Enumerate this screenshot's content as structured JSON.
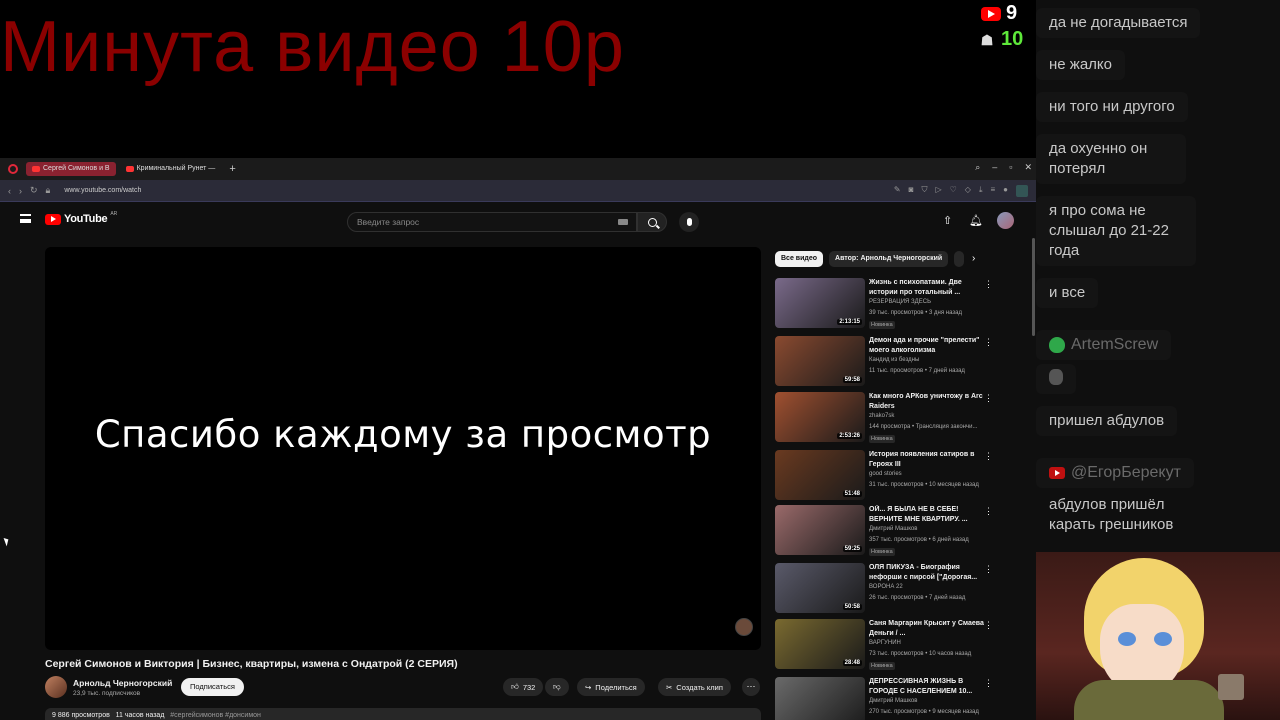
{
  "overlay": {
    "title": "Минута видео 10р",
    "youtube_count": "9",
    "vk_count": "10"
  },
  "chat": {
    "messages": [
      {
        "text": "да не догадывается"
      },
      {
        "text": "не жалко"
      },
      {
        "text": "ни того ни другого"
      },
      {
        "text": "да охуенно он потерял"
      },
      {
        "text": "я про сома не слышал до 21-22 года"
      },
      {
        "text": "и все"
      },
      {
        "user": "ArtemScrew"
      },
      {
        "text": "пришел абдулов"
      },
      {
        "user": "@ЕгорБерекут",
        "text": "абдулов пришёл карать грешников"
      }
    ]
  },
  "browser": {
    "tabs": [
      {
        "label": "Сергей Симонов и В"
      },
      {
        "label": "Криминальный Рунет —"
      }
    ],
    "url": "www.youtube.com/watch"
  },
  "youtube": {
    "logo_text": "YouTube",
    "logo_region": "AR",
    "search_placeholder": "Введите запрос",
    "player_text": "Спасибо каждому за просмотр",
    "video_title": "Сергей Симонов и Виктория | Бизнес, квартиры, измена с Ондатрой (2 СЕРИЯ)",
    "channel_name": "Арнольд Черногорский",
    "channel_subs": "23,9 тыс. подписчиков",
    "subscribe_label": "Подписаться",
    "likes": "732",
    "share_label": "Поделиться",
    "clip_label": "Создать клип",
    "views": "9 886 просмотров",
    "published": "11 часов назад",
    "tags": "#сергейсимонов #донсимон",
    "chips": [
      "Все видео",
      "Автор: Арнольд Черногорский"
    ],
    "recommendations": [
      {
        "title": "Жизнь с психопатами. Две истории про тотальный ...",
        "channel": "РЕЗЕРВАЦИЯ ЗДЕСЬ",
        "meta": "39 тыс. просмотров • 3 дня назад",
        "badge": "Новинка",
        "duration": "2:13:15",
        "color": "#7a6a8a"
      },
      {
        "title": "Демон ада и прочие \"прелести\" моего алкоголизма",
        "channel": "Кандид из бездны",
        "meta": "11 тыс. просмотров • 7 дней назад",
        "badge": "",
        "duration": "59:58",
        "color": "#8a4a30"
      },
      {
        "title": "Как много АРКов уничтожу в Arc Raiders",
        "channel": "zhako7sk",
        "meta": "144 просмотра • Трансляция закончи...",
        "badge": "Новинка",
        "duration": "2:53:26",
        "color": "#a05030"
      },
      {
        "title": "История появления сатиров в Героях III",
        "channel": "good stories",
        "meta": "31 тыс. просмотров • 10 месяцев назад",
        "badge": "",
        "duration": "51:48",
        "color": "#6a3a20"
      },
      {
        "title": "ОЙ... Я БЫЛА НЕ В СЕБЕ! ВЕРНИТЕ МНЕ КВАРТИРУ. ...",
        "channel": "Дмитрий Машков",
        "meta": "357 тыс. просмотров • 6 дней назад",
        "badge": "Новинка",
        "duration": "59:25",
        "color": "#9a6a6a"
      },
      {
        "title": "ОЛЯ ПИКУЗА - Биография нефорши с пирсой [\"Дорогая...",
        "channel": "ВОРОНА 22",
        "meta": "26 тыс. просмотров • 7 дней назад",
        "badge": "",
        "duration": "50:58",
        "color": "#5a5a6a"
      },
      {
        "title": "Саня Маргарин Крысит у Смаева Деньги / ...",
        "channel": "ВАРГУНИН",
        "meta": "73 тыс. просмотров • 10 часов назад",
        "badge": "Новинка",
        "duration": "28:48",
        "color": "#7a6a30"
      },
      {
        "title": "ДЕПРЕССИВНАЯ ЖИЗНЬ В ГОРОДЕ С НАСЕЛЕНИЕМ 10...",
        "channel": "Дмитрий Машков",
        "meta": "270 тыс. просмотров • 9 месяцев назад",
        "badge": "",
        "duration": "",
        "color": "#6a6a6a"
      }
    ]
  },
  "colors": {
    "accent": "#ff0000",
    "overlay_title": "#8b0000",
    "vk_counter": "#5ee83a"
  }
}
